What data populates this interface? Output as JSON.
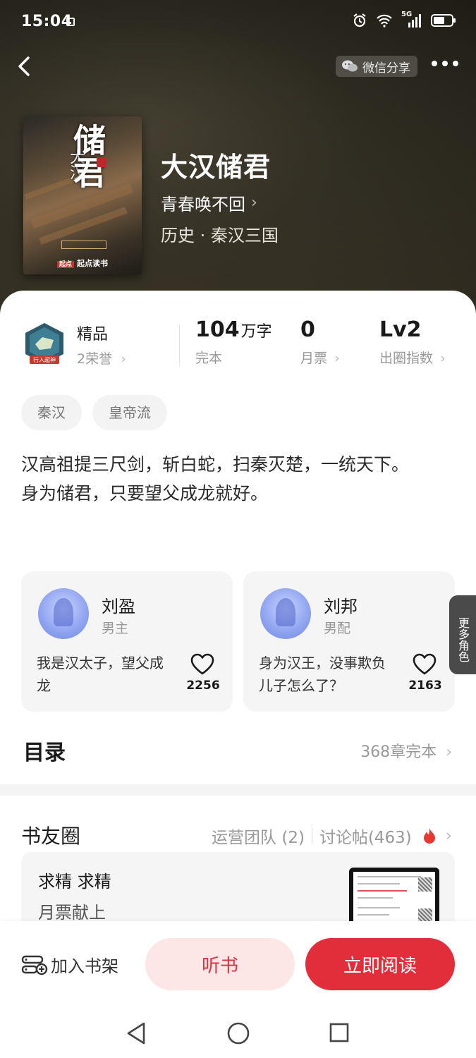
{
  "status_bar": {
    "time": "15:04",
    "network": "5G"
  },
  "nav": {
    "share_label": "微信分享"
  },
  "cover": {
    "title_big": "储君",
    "title_small": "大汉",
    "publisher": "起点读书",
    "publisher_badge": "起点"
  },
  "book": {
    "title": "大汉储君",
    "author": "青春唤不回",
    "category": "历史 · 秦汉三国"
  },
  "stats": {
    "award": {
      "title": "精品",
      "sub": "2荣誉",
      "badge": "行入超神"
    },
    "words": {
      "value": "104",
      "unit": "万字",
      "label": "完本"
    },
    "tickets": {
      "value": "0",
      "label": "月票"
    },
    "level": {
      "value": "Lv2",
      "label": "出圈指数"
    }
  },
  "tags": [
    "秦汉",
    "皇帝流"
  ],
  "description": "汉高祖提三尺剑，斩白蛇，扫秦灭楚，一统天下。\n身为储君，只要望父成龙就好。",
  "characters": [
    {
      "name": "刘盈",
      "role": "男主",
      "quote": "我是汉太子，望父成龙",
      "likes": "2256"
    },
    {
      "name": "刘邦",
      "role": "男配",
      "quote": "身为汉王，没事欺负儿子怎么了？",
      "likes": "2163"
    }
  ],
  "more_roles": "更多角色",
  "catalog": {
    "title": "目录",
    "summary": "368章完本"
  },
  "book_circle": {
    "title": "书友圈",
    "team": "运营团队 (2)",
    "posts": "讨论帖(463)",
    "post": {
      "line1": "求精 求精",
      "line2": "月票献上"
    }
  },
  "bottom_bar": {
    "shelf": "加入书架",
    "listen": "听书",
    "read": "立即阅读"
  },
  "colors": {
    "accent_red": "#e22d3b",
    "listen_bg": "#fde6e6"
  }
}
